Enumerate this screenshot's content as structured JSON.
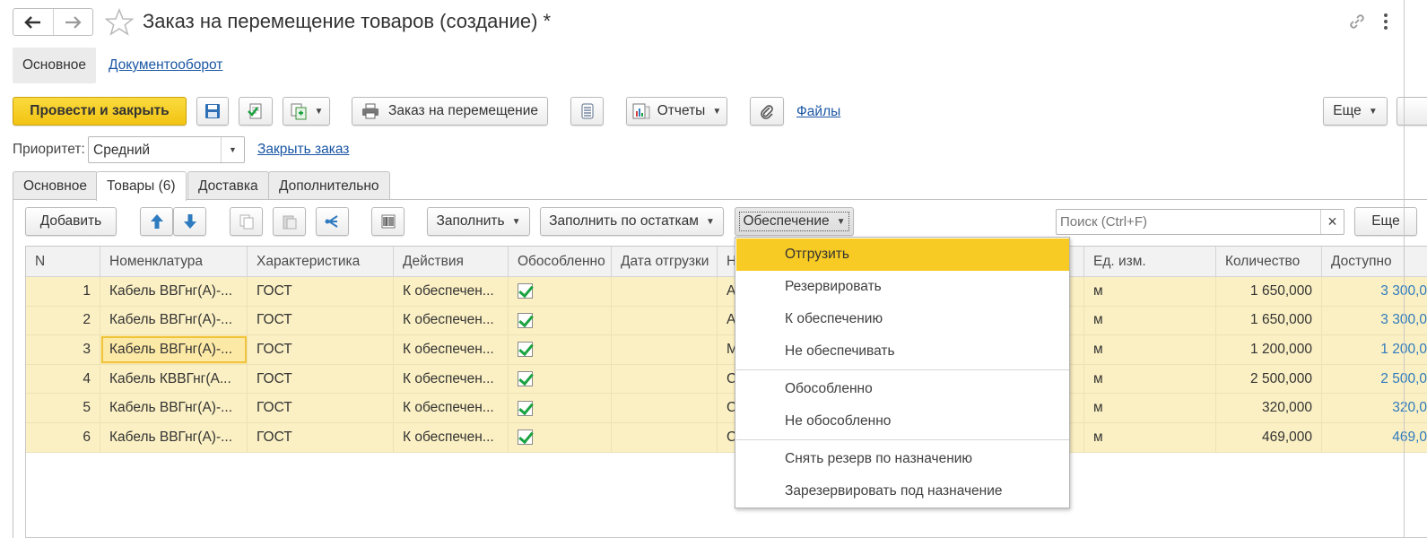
{
  "window": {
    "title": "Заказ на перемещение товаров (создание) *"
  },
  "nav": {
    "main_label": "Основное",
    "docflow_link": "Документооборот"
  },
  "toolbar": {
    "post_close": "Провести и закрыть",
    "print_order": "Заказ на перемещение",
    "reports": "Отчеты",
    "files": "Файлы",
    "more": "Еще"
  },
  "priority": {
    "label": "Приоритет:",
    "value": "Средний",
    "close_order_link": "Закрыть заказ"
  },
  "tabs": [
    "Основное",
    "Товары (6)",
    "Доставка",
    "Дополнительно"
  ],
  "goods_toolbar": {
    "add": "Добавить",
    "fill": "Заполнить",
    "fill_by_stock": "Заполнить по остаткам",
    "provision": "Обеспечение",
    "search_placeholder": "Поиск (Ctrl+F)",
    "more": "Еще",
    "clear_search": "×"
  },
  "table": {
    "columns": [
      "N",
      "Номенклатура",
      "Характеристика",
      "Действия",
      "Обособленно",
      "Дата отгрузки",
      "Н",
      "Ед. изм.",
      "Количество",
      "Доступно"
    ],
    "rows": [
      {
        "n": "1",
        "item": "Кабель ВВГнг(А)-...",
        "char": "ГОСТ",
        "action": "К обеспечен...",
        "separate": true,
        "date": "",
        "partial": "А",
        "unit": "м",
        "qty": "1 650,000",
        "avail": "3 300,0"
      },
      {
        "n": "2",
        "item": "Кабель ВВГнг(А)-...",
        "char": "ГОСТ",
        "action": "К обеспечен...",
        "separate": true,
        "date": "",
        "partial": "А",
        "unit": "м",
        "qty": "1 650,000",
        "avail": "3 300,0"
      },
      {
        "n": "3",
        "item": "Кабель ВВГнг(А)-...",
        "char": "ГОСТ",
        "action": "К обеспечен...",
        "separate": true,
        "date": "",
        "partial": "М",
        "unit": "м",
        "qty": "1 200,000",
        "avail": "1 200,0"
      },
      {
        "n": "4",
        "item": "Кабель КВВГнг(А...",
        "char": "ГОСТ",
        "action": "К обеспечен...",
        "separate": true,
        "date": "",
        "partial": "С",
        "unit": "м",
        "qty": "2 500,000",
        "avail": "2 500,0"
      },
      {
        "n": "5",
        "item": "Кабель ВВГнг(А)-...",
        "char": "ГОСТ",
        "action": "К обеспечен...",
        "separate": true,
        "date": "",
        "partial": "С",
        "unit": "м",
        "qty": "320,000",
        "avail": "320,0"
      },
      {
        "n": "6",
        "item": "Кабель ВВГнг(А)-...",
        "char": "ГОСТ",
        "action": "К обеспечен...",
        "separate": true,
        "date": "",
        "partial": "С",
        "unit": "м",
        "qty": "469,000",
        "avail": "469,0"
      }
    ]
  },
  "provision_menu": {
    "items": [
      "Отгрузить",
      "Резервировать",
      "К обеспечению",
      "Не обеспечивать",
      "Обособленно",
      "Не обособленно",
      "Снять резерв по назначению",
      "Зарезервировать под назначение"
    ]
  },
  "colors": {
    "accent_yellow": "#f7cb24",
    "row_highlight": "#fbf0c3",
    "link_blue": "#1a56a4",
    "check_green": "#1aa340"
  }
}
